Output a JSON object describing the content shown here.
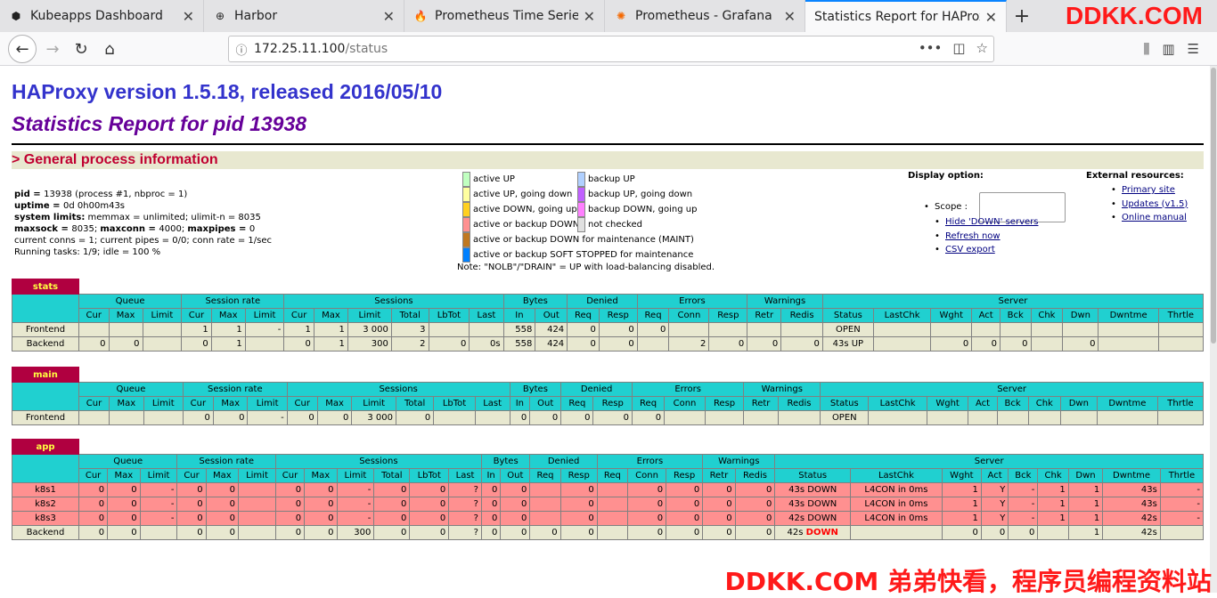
{
  "browser": {
    "tabs": [
      {
        "title": "Kubeapps Dashboard",
        "icon": "kubeapps-icon"
      },
      {
        "title": "Harbor",
        "icon": "harbor-icon"
      },
      {
        "title": "Prometheus Time Series C",
        "icon": "prometheus-icon"
      },
      {
        "title": "Prometheus - Grafana",
        "icon": "grafana-icon"
      },
      {
        "title": "Statistics Report for HAProxy",
        "icon": "none",
        "active": true
      }
    ],
    "url_host": "172.25.11.100",
    "url_path": "/status",
    "close_glyph": "✕",
    "new_tab_glyph": "+"
  },
  "watermark": {
    "top": "DDKK.COM",
    "bottom": "DDKK.COM 弟弟快看，程序员编程资料站"
  },
  "page": {
    "title": "HAProxy version 1.5.18, released 2016/05/10",
    "subtitle": "Statistics Report for pid 13938",
    "section": "> General process information",
    "proc_lines": [
      {
        "bold": "pid = ",
        "text": "13938 (process #1, nbproc = 1)"
      },
      {
        "bold": "uptime = ",
        "text": "0d 0h00m43s"
      },
      {
        "bold": "system limits:",
        "text": " memmax = unlimited; ulimit-n = 8035"
      },
      {
        "bold": "maxsock = ",
        "text": "8035; ",
        "bold2": "maxconn = ",
        "text2": "4000; ",
        "bold3": "maxpipes = ",
        "text3": "0"
      },
      {
        "bold": "",
        "text": "current conns = 1; current pipes = 0/0; conn rate = 1/sec"
      },
      {
        "bold": "",
        "text": "Running tasks: 1/9; idle = 100 %"
      }
    ],
    "legend": {
      "left": [
        {
          "label": "active UP",
          "color": "#c0ffc0"
        },
        {
          "label": "active UP, going down",
          "color": "#ffffa0"
        },
        {
          "label": "active DOWN, going up",
          "color": "#ffd020"
        },
        {
          "label": "active or backup DOWN",
          "color": "#ff9090"
        },
        {
          "label": "active or backup DOWN for maintenance (MAINT)",
          "color": "#c07820"
        },
        {
          "label": "active or backup SOFT STOPPED for maintenance",
          "color": "#0080ff"
        }
      ],
      "right": [
        {
          "label": "backup UP",
          "color": "#b0d0ff"
        },
        {
          "label": "backup UP, going down",
          "color": "#c060ff"
        },
        {
          "label": "backup DOWN, going up",
          "color": "#ff80ff"
        },
        {
          "label": "not checked",
          "color": "#e0e0e0"
        }
      ],
      "note": "Note: \"NOLB\"/\"DRAIN\" = UP with load-balancing disabled."
    },
    "display_option": {
      "title": "Display option:",
      "scope_label": "Scope :",
      "links": [
        "Hide 'DOWN' servers",
        "Refresh now",
        "CSV export"
      ]
    },
    "external_resources": {
      "title": "External resources:",
      "links": [
        "Primary site",
        "Updates (v1.5)",
        "Online manual"
      ]
    }
  },
  "groups": [
    "Queue",
    "Session rate",
    "Sessions",
    "Bytes",
    "Denied",
    "Errors",
    "Warnings",
    "Server"
  ],
  "columns": [
    "Cur",
    "Max",
    "Limit",
    "Cur",
    "Max",
    "Limit",
    "Cur",
    "Max",
    "Limit",
    "Total",
    "LbTot",
    "Last",
    "In",
    "Out",
    "Req",
    "Resp",
    "Req",
    "Conn",
    "Resp",
    "Retr",
    "Redis",
    "Status",
    "LastChk",
    "Wght",
    "Act",
    "Bck",
    "Chk",
    "Dwn",
    "Dwntme",
    "Thrtle"
  ],
  "proxies": [
    {
      "name": "stats",
      "rows": [
        {
          "kind": "fe",
          "label": "Frontend",
          "cells": [
            "",
            "",
            "",
            "1",
            "1",
            "-",
            "1",
            "1",
            "3 000",
            "3",
            "",
            "",
            "558",
            "424",
            "0",
            "0",
            "0",
            "",
            "",
            "",
            "",
            "OPEN",
            "",
            "",
            "",
            "",
            "",
            "",
            "",
            ""
          ]
        },
        {
          "kind": "be",
          "label": "Backend",
          "cells": [
            "0",
            "0",
            "",
            "0",
            "1",
            "",
            "0",
            "1",
            "300",
            "2",
            "0",
            "0s",
            "558",
            "424",
            "0",
            "0",
            "",
            "2",
            "0",
            "0",
            "0",
            "43s UP",
            "",
            "0",
            "0",
            "0",
            "",
            "0",
            "",
            ""
          ]
        }
      ]
    },
    {
      "name": "main",
      "rows": [
        {
          "kind": "fe",
          "label": "Frontend",
          "cells": [
            "",
            "",
            "",
            "0",
            "0",
            "-",
            "0",
            "0",
            "3 000",
            "0",
            "",
            "",
            "0",
            "0",
            "0",
            "0",
            "0",
            "",
            "",
            "",
            "",
            "OPEN",
            "",
            "",
            "",
            "",
            "",
            "",
            "",
            ""
          ]
        }
      ]
    },
    {
      "name": "app",
      "rows": [
        {
          "kind": "down",
          "label": "k8s1",
          "cells": [
            "0",
            "0",
            "-",
            "0",
            "0",
            "",
            "0",
            "0",
            "-",
            "0",
            "0",
            "?",
            "0",
            "0",
            "",
            "0",
            "",
            "0",
            "0",
            "0",
            "0",
            "43s DOWN",
            "L4CON in 0ms",
            "1",
            "Y",
            "-",
            "1",
            "1",
            "43s",
            "-"
          ]
        },
        {
          "kind": "down",
          "label": "k8s2",
          "cells": [
            "0",
            "0",
            "-",
            "0",
            "0",
            "",
            "0",
            "0",
            "-",
            "0",
            "0",
            "?",
            "0",
            "0",
            "",
            "0",
            "",
            "0",
            "0",
            "0",
            "0",
            "43s DOWN",
            "L4CON in 0ms",
            "1",
            "Y",
            "-",
            "1",
            "1",
            "43s",
            "-"
          ]
        },
        {
          "kind": "down",
          "label": "k8s3",
          "cells": [
            "0",
            "0",
            "-",
            "0",
            "0",
            "",
            "0",
            "0",
            "-",
            "0",
            "0",
            "?",
            "0",
            "0",
            "",
            "0",
            "",
            "0",
            "0",
            "0",
            "0",
            "42s DOWN",
            "L4CON in 0ms",
            "1",
            "Y",
            "-",
            "1",
            "1",
            "42s",
            "-"
          ]
        },
        {
          "kind": "be",
          "label": "Backend",
          "cells": [
            "0",
            "0",
            "",
            "0",
            "0",
            "",
            "0",
            "0",
            "300",
            "0",
            "0",
            "?",
            "0",
            "0",
            "0",
            "0",
            "",
            "0",
            "0",
            "0",
            "0",
            "42s DOWN",
            "",
            "0",
            "0",
            "0",
            "",
            "1",
            "42s",
            ""
          ]
        }
      ]
    }
  ]
}
